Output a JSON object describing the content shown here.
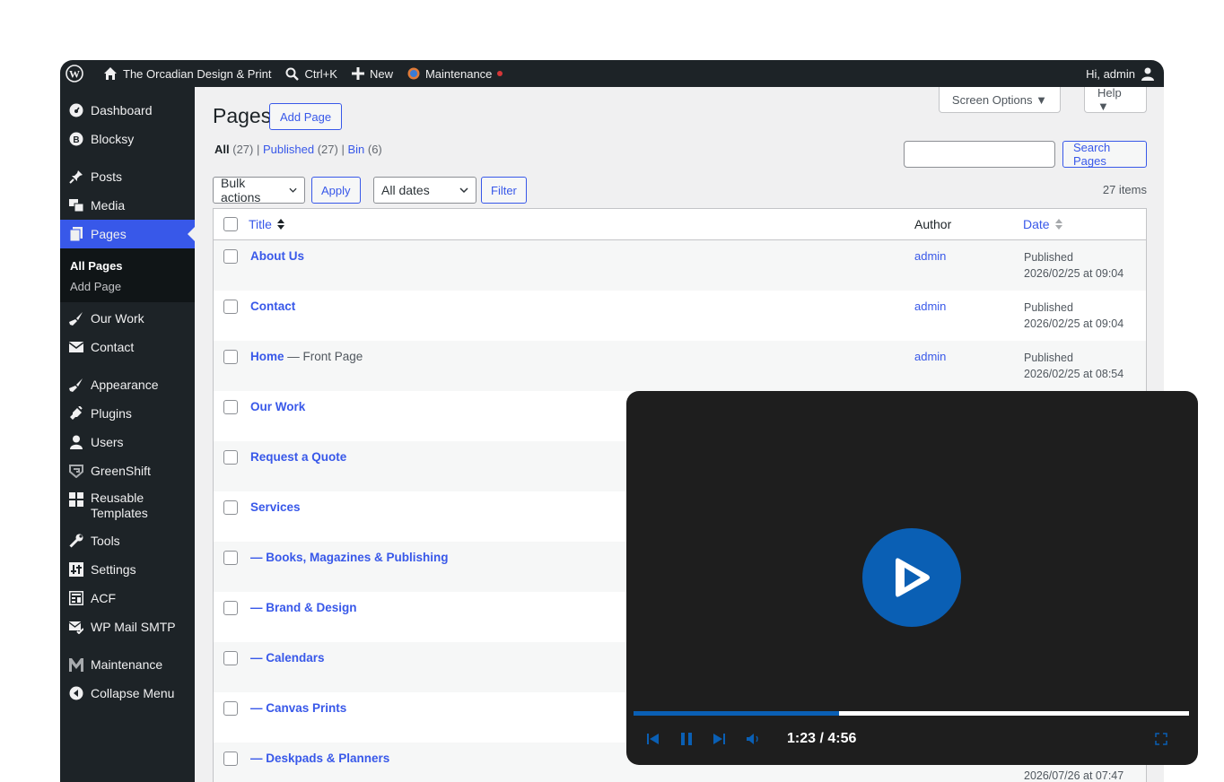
{
  "admin_bar": {
    "site_name": "The Orcadian Design & Print",
    "search_shortcut": "Ctrl+K",
    "new_label": "New",
    "maintenance_label": "Maintenance",
    "greeting": "Hi, admin"
  },
  "sidebar": {
    "items": [
      {
        "label": "Dashboard",
        "icon": "dashboard-icon"
      },
      {
        "label": "Blocksy",
        "icon": "blocksy-icon"
      },
      {
        "label": "Posts",
        "icon": "pin-icon"
      },
      {
        "label": "Media",
        "icon": "media-icon"
      },
      {
        "label": "Pages",
        "icon": "pages-icon"
      },
      {
        "label": "Our Work",
        "icon": "brush-icon"
      },
      {
        "label": "Contact",
        "icon": "envelope-icon"
      },
      {
        "label": "Appearance",
        "icon": "appearance-icon"
      },
      {
        "label": "Plugins",
        "icon": "plugin-icon"
      },
      {
        "label": "Users",
        "icon": "user-icon"
      },
      {
        "label": "GreenShift",
        "icon": "greenshift-icon"
      },
      {
        "label": "Reusable Templates",
        "icon": "grid-icon"
      },
      {
        "label": "Tools",
        "icon": "wrench-icon"
      },
      {
        "label": "Settings",
        "icon": "settings-icon"
      },
      {
        "label": "ACF",
        "icon": "acf-icon"
      },
      {
        "label": "WP Mail SMTP",
        "icon": "mail-smtp-icon"
      },
      {
        "label": "Maintenance",
        "icon": "maintenance-icon"
      },
      {
        "label": "Collapse Menu",
        "icon": "collapse-icon"
      }
    ],
    "submenu": {
      "all_pages": "All Pages",
      "add_page": "Add Page"
    }
  },
  "header": {
    "screen_options": "Screen Options ▼",
    "help": "Help ▼",
    "title": "Pages",
    "add_page": "Add Page"
  },
  "filters": {
    "all": "All",
    "all_count": "(27)",
    "published": "Published",
    "published_count": "(27)",
    "bin": "Bin",
    "bin_count": "(6)",
    "search_button": "Search Pages",
    "bulk_actions": "Bulk actions",
    "apply": "Apply",
    "all_dates": "All dates",
    "filter": "Filter",
    "items_count": "27 items"
  },
  "table": {
    "col_title": "Title",
    "col_author": "Author",
    "col_date": "Date",
    "rows": [
      {
        "title": "About Us",
        "suffix": "",
        "author": "admin",
        "status": "Published",
        "date": "2026/02/25 at 09:04"
      },
      {
        "title": "Contact",
        "suffix": "",
        "author": "admin",
        "status": "Published",
        "date": "2026/02/25 at 09:04"
      },
      {
        "title": "Home",
        "suffix": " — Front Page",
        "author": "admin",
        "status": "Published",
        "date": "2026/02/25 at 08:54"
      },
      {
        "title": "Our Work",
        "suffix": "",
        "author": "",
        "status": "",
        "date": ""
      },
      {
        "title": "Request a Quote",
        "suffix": "",
        "author": "",
        "status": "",
        "date": ""
      },
      {
        "title": "Services",
        "suffix": "",
        "author": "",
        "status": "",
        "date": ""
      },
      {
        "title": "— Books, Magazines & Publishing",
        "suffix": "",
        "author": "",
        "status": "",
        "date": ""
      },
      {
        "title": "— Brand & Design",
        "suffix": "",
        "author": "",
        "status": "",
        "date": ""
      },
      {
        "title": "— Calendars",
        "suffix": "",
        "author": "",
        "status": "",
        "date": ""
      },
      {
        "title": "— Canvas Prints",
        "suffix": "",
        "author": "",
        "status": "",
        "date": ""
      },
      {
        "title": "— Deskpads & Planners",
        "suffix": "",
        "author": "",
        "status": "",
        "date": "2026/07/26 at 07:47"
      }
    ]
  },
  "player": {
    "time": "1:23 / 4:56",
    "progress_fraction": 0.37,
    "accent": "#0a5fb4"
  }
}
